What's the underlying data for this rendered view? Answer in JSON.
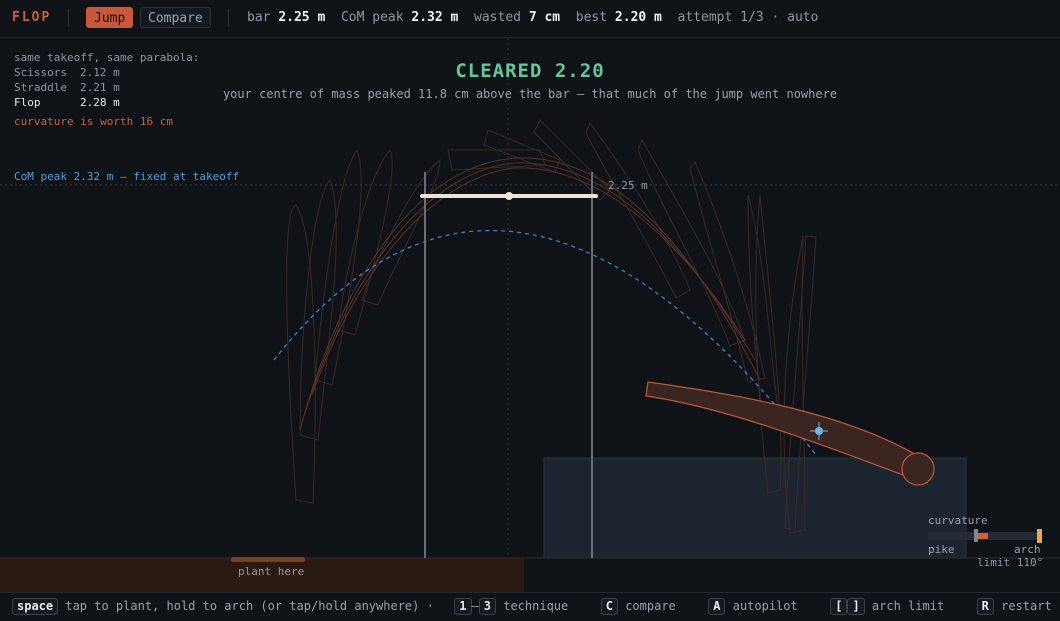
{
  "topbar": {
    "logo": "FLOP",
    "tab_jump": "Jump",
    "tab_compare": "Compare",
    "bar_label": "bar",
    "bar_value": "2.25 m",
    "com_label": "CoM peak",
    "com_value": "2.32 m",
    "wasted_label": "wasted",
    "wasted_value": "7 cm",
    "best_label": "best",
    "best_value": "2.20 m",
    "attempt": "attempt 1/3 · auto"
  },
  "panel": {
    "heading": "same takeoff, same parabola:",
    "rows": [
      {
        "name": "Scissors",
        "value": "2.12 m"
      },
      {
        "name": "Straddle",
        "value": "2.21 m"
      },
      {
        "name": "Flop",
        "value": "2.28 m"
      }
    ],
    "worth": "curvature is worth 16 cm"
  },
  "com_line_label": "CoM peak 2.32 m — fixed at takeoff",
  "result": {
    "title": "CLEARED 2.20",
    "subtitle": "your centre of mass peaked 11.8 cm above the bar — that much of the jump went nowhere"
  },
  "bar_height_label": "2.25 m",
  "plant_label": "plant here",
  "curvature": {
    "label": "curvature",
    "pike": "pike",
    "arch": "arch",
    "limit": "limit 110°",
    "value": 0.45,
    "limit_value": 1.0
  },
  "help": {
    "k_space": "space",
    "t_space": "tap to plant, hold to arch  (or tap/hold anywhere) ·",
    "k_1": "1",
    "dash": "–",
    "k_3": "3",
    "t_technique": "technique",
    "k_c": "C",
    "t_compare": "compare",
    "k_a": "A",
    "t_autopilot": "autopilot",
    "k_lb": "[",
    "k_rb": "]",
    "t_arch": "arch limit",
    "k_r": "R",
    "t_restart": "restart"
  },
  "colors": {
    "accent": "#d0603a",
    "success": "#62c79a",
    "com": "#4aa3e0",
    "limit": "#e7a94a"
  }
}
